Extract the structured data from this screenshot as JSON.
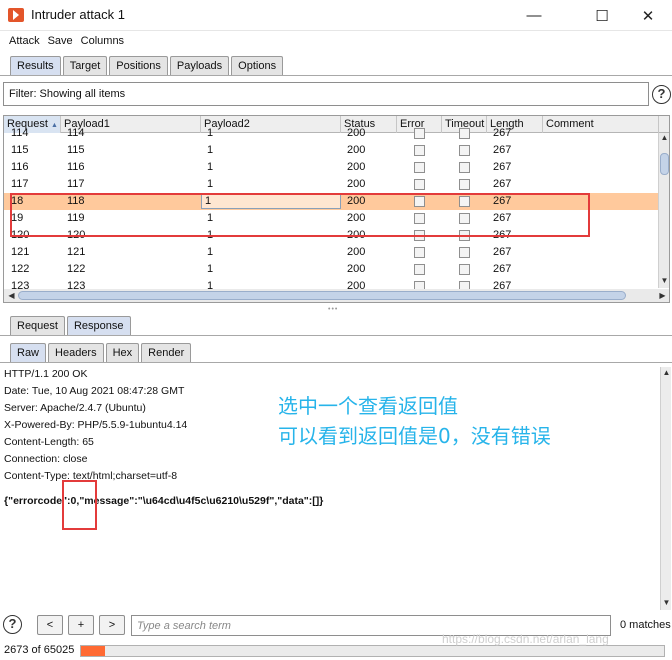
{
  "window": {
    "title": "Intruder attack 1"
  },
  "menu": [
    "Attack",
    "Save",
    "Columns"
  ],
  "main_tabs": [
    {
      "label": "Results",
      "active": true
    },
    {
      "label": "Target",
      "active": false
    },
    {
      "label": "Positions",
      "active": false
    },
    {
      "label": "Payloads",
      "active": false
    },
    {
      "label": "Options",
      "active": false
    }
  ],
  "filter": {
    "text": "Filter: Showing all items"
  },
  "table": {
    "columns": [
      "Request",
      "Payload1",
      "Payload2",
      "Status",
      "Error",
      "Timeout",
      "Length",
      "Comment"
    ],
    "sort_indicator": "▲",
    "rows": [
      {
        "request": "114",
        "payload1": "114",
        "payload2": "1",
        "status": "200",
        "length": "267",
        "selected": false
      },
      {
        "request": "115",
        "payload1": "115",
        "payload2": "1",
        "status": "200",
        "length": "267",
        "selected": false
      },
      {
        "request": "116",
        "payload1": "116",
        "payload2": "1",
        "status": "200",
        "length": "267",
        "selected": false
      },
      {
        "request": "117",
        "payload1": "117",
        "payload2": "1",
        "status": "200",
        "length": "267",
        "selected": false
      },
      {
        "request": "18",
        "payload1": "118",
        "payload2": "1",
        "status": "200",
        "length": "267",
        "selected": true
      },
      {
        "request": "19",
        "payload1": "119",
        "payload2": "1",
        "status": "200",
        "length": "267",
        "selected": false
      },
      {
        "request": "120",
        "payload1": "120",
        "payload2": "1",
        "status": "200",
        "length": "267",
        "selected": false
      },
      {
        "request": "121",
        "payload1": "121",
        "payload2": "1",
        "status": "200",
        "length": "267",
        "selected": false
      },
      {
        "request": "122",
        "payload1": "122",
        "payload2": "1",
        "status": "200",
        "length": "267",
        "selected": false
      },
      {
        "request": "123",
        "payload1": "123",
        "payload2": "1",
        "status": "200",
        "length": "267",
        "selected": false
      }
    ]
  },
  "reqresp_tabs": [
    {
      "label": "Request",
      "active": false
    },
    {
      "label": "Response",
      "active": true
    }
  ],
  "view_tabs": [
    {
      "label": "Raw",
      "active": true
    },
    {
      "label": "Headers",
      "active": false
    },
    {
      "label": "Hex",
      "active": false
    },
    {
      "label": "Render",
      "active": false
    }
  ],
  "response": {
    "lines": [
      "HTTP/1.1 200 OK",
      "Date: Tue, 10 Aug 2021 08:47:28 GMT",
      "Server: Apache/2.4.7 (Ubuntu)",
      "X-Powered-By: PHP/5.5.9-1ubuntu4.14",
      "Content-Length: 65",
      "Connection: close",
      "Content-Type: text/html;charset=utf-8"
    ],
    "body": "{\"errorcode\":0,\"message\":\"\\u64cd\\u4f5c\\u6210\\u529f\",\"data\":[]}"
  },
  "annotation": {
    "line1": "选中一个查看返回值",
    "line2": "可以看到返回值是0，没有错误"
  },
  "search": {
    "help": "?",
    "prev_label": "<",
    "add_label": "+",
    "next_label": ">",
    "placeholder": "Type a search term",
    "matches": "0 matches"
  },
  "status": {
    "progress_text": "2673 of 65025",
    "progress_fraction": 0.0411
  },
  "watermark": "https://blog.csdn.net/arlan_lang",
  "colors": {
    "selected_row": "#ffc99c",
    "annotation_box": "#e33b3b",
    "annotation_text": "#27b4ea",
    "progress": "#ff6a33"
  }
}
